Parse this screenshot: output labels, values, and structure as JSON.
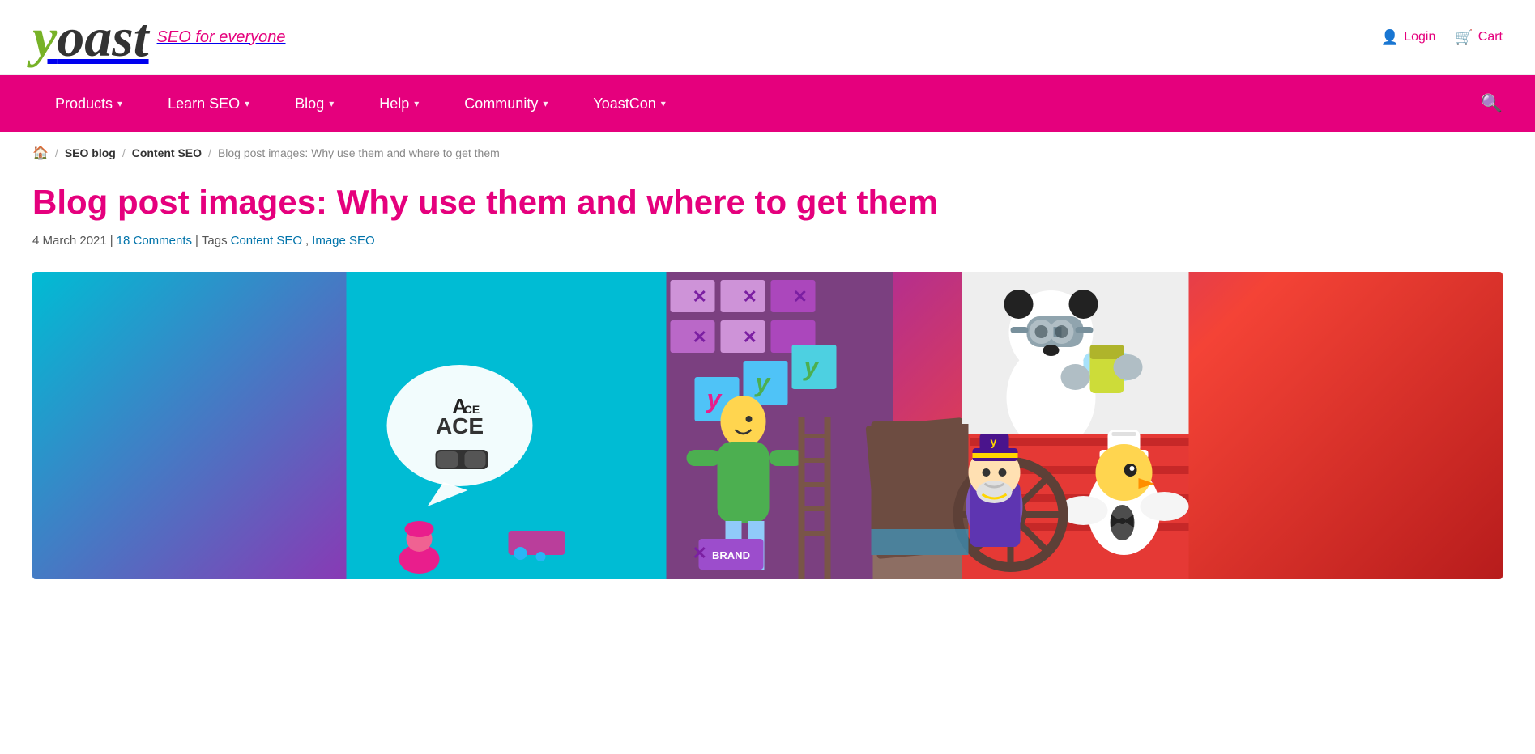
{
  "site": {
    "logo_y": "y",
    "logo_rest": "oast",
    "logo_tagline": "SEO for everyone",
    "logo_url": "/"
  },
  "header": {
    "login_label": "Login",
    "cart_label": "Cart"
  },
  "nav": {
    "items": [
      {
        "id": "products",
        "label": "Products",
        "has_dropdown": true
      },
      {
        "id": "learn-seo",
        "label": "Learn SEO",
        "has_dropdown": true
      },
      {
        "id": "blog",
        "label": "Blog",
        "has_dropdown": true
      },
      {
        "id": "help",
        "label": "Help",
        "has_dropdown": true
      },
      {
        "id": "community",
        "label": "Community",
        "has_dropdown": true
      },
      {
        "id": "yoastcon",
        "label": "YoastCon",
        "has_dropdown": true
      }
    ]
  },
  "breadcrumb": {
    "home_icon": "⌂",
    "sep": "/",
    "items": [
      {
        "label": "SEO blog",
        "url": "#",
        "is_link": true
      },
      {
        "label": "Content SEO",
        "url": "#",
        "is_link": true
      },
      {
        "label": "Blog post images: Why use them and where to get them",
        "is_current": true
      }
    ]
  },
  "article": {
    "title": "Blog post images: Why use them and where to get them",
    "date": "4 March 2021",
    "separator": "|",
    "comments_label": "18 Comments",
    "tags_label": "Tags",
    "tags": [
      {
        "label": "Content SEO",
        "url": "#"
      },
      {
        "label": "Image SEO",
        "url": "#"
      }
    ]
  },
  "colors": {
    "pink": "#e5007d",
    "nav_bg": "#e5007d",
    "green": "#77b227",
    "blue": "#0073aa",
    "dark": "#333333"
  }
}
